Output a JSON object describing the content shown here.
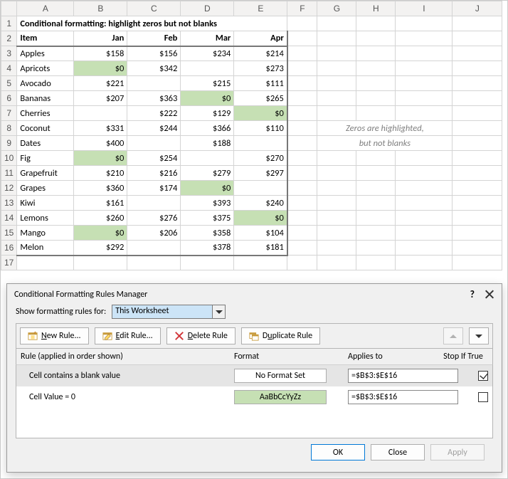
{
  "sheet": {
    "columns": [
      "A",
      "B",
      "C",
      "D",
      "E",
      "F",
      "G",
      "H",
      "I",
      "J"
    ],
    "title": "Conditional formatting: highlight zeros but not blanks",
    "headers": {
      "item": "Item",
      "m1": "Jan",
      "m2": "Feb",
      "m3": "Mar",
      "m4": "Apr"
    },
    "rows": [
      {
        "item": "Apples",
        "v": [
          "$158",
          "$156",
          "$234",
          "$214"
        ],
        "z": [
          false,
          false,
          false,
          false
        ]
      },
      {
        "item": "Apricots",
        "v": [
          "$0",
          "$342",
          "",
          "$273"
        ],
        "z": [
          true,
          false,
          false,
          false
        ]
      },
      {
        "item": "Avocado",
        "v": [
          "$221",
          "",
          "$215",
          "$111"
        ],
        "z": [
          false,
          false,
          false,
          false
        ]
      },
      {
        "item": "Bananas",
        "v": [
          "$207",
          "$363",
          "$0",
          "$265"
        ],
        "z": [
          false,
          false,
          true,
          false
        ]
      },
      {
        "item": "Cherries",
        "v": [
          "",
          "$222",
          "$129",
          "$0"
        ],
        "z": [
          false,
          false,
          false,
          true
        ]
      },
      {
        "item": "Coconut",
        "v": [
          "$331",
          "$244",
          "$366",
          "$110"
        ],
        "z": [
          false,
          false,
          false,
          false
        ]
      },
      {
        "item": "Dates",
        "v": [
          "$400",
          "",
          "$188",
          ""
        ],
        "z": [
          false,
          false,
          false,
          false
        ]
      },
      {
        "item": "Fig",
        "v": [
          "$0",
          "$254",
          "",
          "$270"
        ],
        "z": [
          true,
          false,
          false,
          false
        ]
      },
      {
        "item": "Grapefruit",
        "v": [
          "$210",
          "$216",
          "$279",
          "$297"
        ],
        "z": [
          false,
          false,
          false,
          false
        ]
      },
      {
        "item": "Grapes",
        "v": [
          "$360",
          "$174",
          "$0",
          ""
        ],
        "z": [
          false,
          false,
          true,
          false
        ]
      },
      {
        "item": "Kiwi",
        "v": [
          "$161",
          "",
          "$393",
          "$240"
        ],
        "z": [
          false,
          false,
          false,
          false
        ]
      },
      {
        "item": "Lemons",
        "v": [
          "$260",
          "$276",
          "$375",
          "$0"
        ],
        "z": [
          false,
          false,
          false,
          true
        ]
      },
      {
        "item": "Mango",
        "v": [
          "$0",
          "$206",
          "$358",
          "$104"
        ],
        "z": [
          true,
          false,
          false,
          false
        ]
      },
      {
        "item": "Melon",
        "v": [
          "$292",
          "",
          "$378",
          "$181"
        ],
        "z": [
          false,
          false,
          false,
          false
        ]
      }
    ],
    "note_line1": "Zeros are highlighted,",
    "note_line2": "but not blanks"
  },
  "dialog": {
    "title": "Conditional Formatting Rules Manager",
    "scope_label": "Show formatting rules for:",
    "scope_value": "This Worksheet",
    "buttons": {
      "new": "New Rule...",
      "edit": "Edit Rule...",
      "delete": "Delete Rule",
      "duplicate": "Duplicate Rule"
    },
    "headers": {
      "rule": "Rule (applied in order shown)",
      "format": "Format",
      "applies": "Applies to",
      "stop": "Stop If True"
    },
    "rules": [
      {
        "desc": "Cell contains a blank value",
        "format_label": "No Format Set",
        "format_green": false,
        "applies": "=$B$3:$E$16",
        "stop": true,
        "selected": true
      },
      {
        "desc": "Cell Value = 0",
        "format_label": "AaBbCcYyZz",
        "format_green": true,
        "applies": "=$B$3:$E$16",
        "stop": false,
        "selected": false
      }
    ],
    "footer": {
      "ok": "OK",
      "close": "Close",
      "apply": "Apply"
    }
  }
}
